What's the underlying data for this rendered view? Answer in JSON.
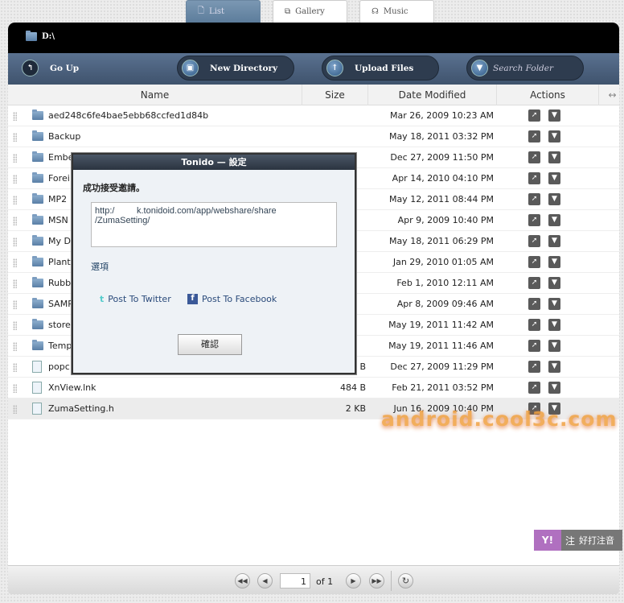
{
  "tabs": [
    {
      "label": "List",
      "icon": "file-icon"
    },
    {
      "label": "Gallery",
      "icon": "gallery-icon"
    },
    {
      "label": "Music",
      "icon": "headphones-icon"
    }
  ],
  "path": "D:\\",
  "toolbar": {
    "go_up": "Go Up",
    "new_directory": "New Directory",
    "upload_files": "Upload Files",
    "search_placeholder": "Search Folder"
  },
  "columns": {
    "name": "Name",
    "size": "Size",
    "date": "Date Modified",
    "actions": "Actions"
  },
  "rows": [
    {
      "name": "aed248c6fe4bae5ebb68ccfed1d84b",
      "size": "",
      "date": "Mar 26, 2009 10:23 AM",
      "type": "folder"
    },
    {
      "name": "Backup",
      "size": "",
      "date": "May 18, 2011 03:32 PM",
      "type": "folder"
    },
    {
      "name": "Embe",
      "size": "",
      "date": "Dec 27, 2009 11:50 PM",
      "type": "folder"
    },
    {
      "name": "Forei",
      "size": "",
      "date": "Apr 14, 2010 04:10 PM",
      "type": "folder"
    },
    {
      "name": "MP2",
      "size": "",
      "date": "May 12, 2011 08:44 PM",
      "type": "folder"
    },
    {
      "name": "MSN",
      "size": "",
      "date": "Apr 9, 2009 10:40 PM",
      "type": "folder"
    },
    {
      "name": "My Do",
      "size": "",
      "date": "May 18, 2011 06:29 PM",
      "type": "folder"
    },
    {
      "name": "Plants",
      "size": "",
      "date": "Jan 29, 2010 01:05 AM",
      "type": "folder"
    },
    {
      "name": "Rubb",
      "size": "",
      "date": "Feb 1, 2010 12:11 AM",
      "type": "folder"
    },
    {
      "name": "SAMP",
      "size": "",
      "date": "Apr 8, 2009 09:46 AM",
      "type": "folder"
    },
    {
      "name": "store",
      "size": "",
      "date": "May 19, 2011 11:42 AM",
      "type": "folder"
    },
    {
      "name": "Temp",
      "size": "",
      "date": "May 19, 2011 11:46 AM",
      "type": "folder"
    },
    {
      "name": "popc",
      "size": "4 B",
      "date": "Dec 27, 2009 11:29 PM",
      "type": "shortcut"
    },
    {
      "name": "XnView.lnk",
      "size": "484 B",
      "date": "Feb 21, 2011 03:52 PM",
      "type": "file"
    },
    {
      "name": "ZumaSetting.h",
      "size": "2 KB",
      "date": "Jun 16, 2009 10:40 PM",
      "type": "file",
      "selected": true
    }
  ],
  "pager": {
    "page": "1",
    "of_label": "of",
    "total": "1"
  },
  "dialog": {
    "title": "Tonido — 設定",
    "message": "成功接受邀請。",
    "url": "http:/         k.tonidoid.com/app/webshare/share\n/ZumaSetting/",
    "options_link": "選項",
    "twitter": "Post To Twitter",
    "facebook": "Post To Facebook",
    "ok": "確認"
  },
  "watermark": "android.cool3c.com",
  "ime": {
    "label": "注",
    "text": "好打注音"
  }
}
